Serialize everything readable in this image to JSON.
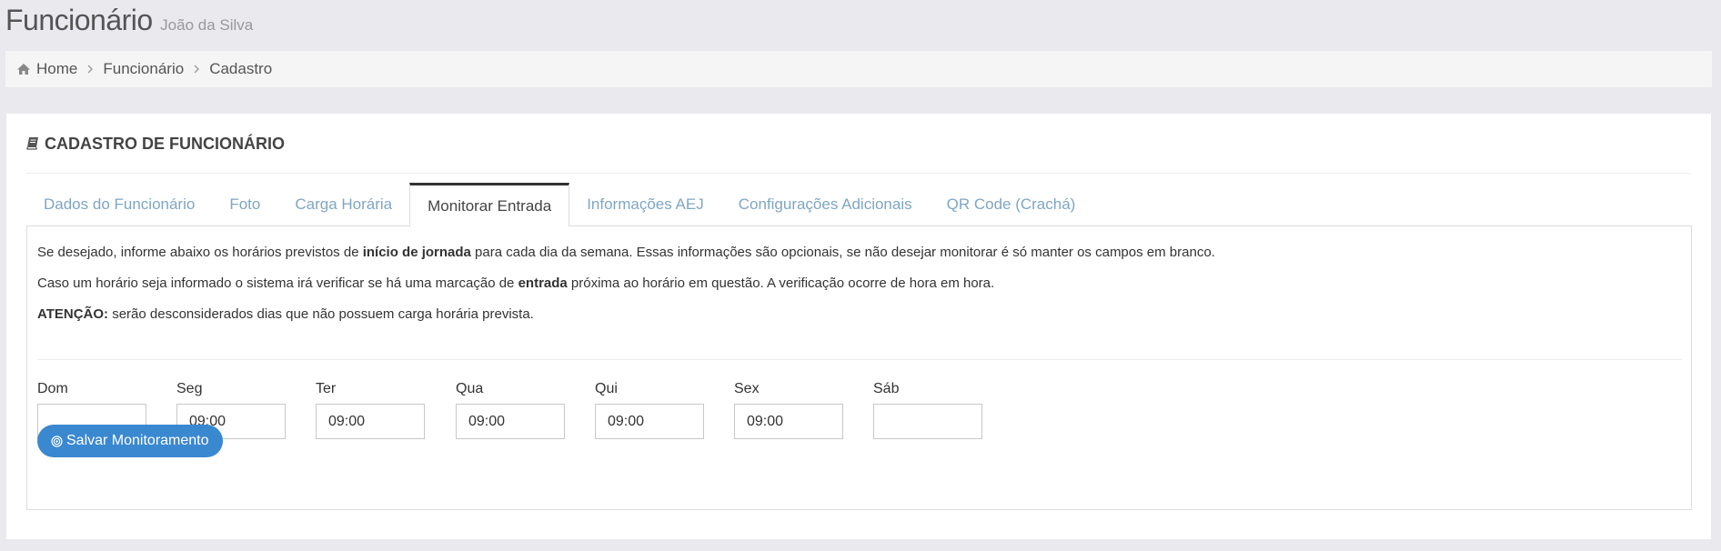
{
  "header": {
    "title": "Funcionário",
    "subtitle": "João da Silva"
  },
  "breadcrumb": {
    "items": [
      "Home",
      "Funcionário",
      "Cadastro"
    ]
  },
  "portlet": {
    "title": "CADASTRO DE FUNCIONÁRIO"
  },
  "tabs": [
    {
      "label": "Dados do Funcionário"
    },
    {
      "label": "Foto"
    },
    {
      "label": "Carga Horária"
    },
    {
      "label": "Monitorar Entrada",
      "active": true
    },
    {
      "label": "Informações AEJ"
    },
    {
      "label": "Configurações Adicionais"
    },
    {
      "label": "QR Code (Crachá)"
    }
  ],
  "content": {
    "p1_a": "Se desejado, informe abaixo os horários previstos de ",
    "p1_b": "início de jornada",
    "p1_c": " para cada dia da semana. Essas informações são opcionais, se não desejar monitorar é só manter os campos em branco.",
    "p2_a": "Caso um horário seja informado o sistema irá verificar se há uma marcação de ",
    "p2_b": "entrada",
    "p2_c": " próxima ao horário em questão. A verificação ocorre de hora em hora.",
    "p3_a": "ATENÇÃO:",
    "p3_b": " serão desconsiderados dias que não possuem carga horária prevista."
  },
  "days": [
    {
      "label": "Dom",
      "value": ""
    },
    {
      "label": "Seg",
      "value": "09:00"
    },
    {
      "label": "Ter",
      "value": "09:00"
    },
    {
      "label": "Qua",
      "value": "09:00"
    },
    {
      "label": "Qui",
      "value": "09:00"
    },
    {
      "label": "Sex",
      "value": "09:00"
    },
    {
      "label": "Sáb",
      "value": ""
    }
  ],
  "save_button": {
    "label": "Salvar Monitoramento",
    "icon": "target-icon",
    "color": "#3a88d0"
  },
  "icons": {
    "home": "home-icon",
    "separator": "chevron-right-icon",
    "title": "book-icon"
  }
}
